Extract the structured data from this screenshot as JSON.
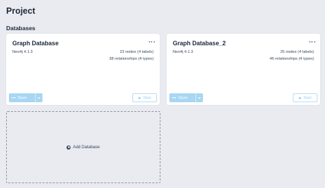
{
  "page": {
    "title": "Project"
  },
  "section": {
    "title": "Databases"
  },
  "cards": [
    {
      "name": "Graph Database",
      "version": "Neo4j 4.1.3",
      "nodes": "23 nodes (4 labels)",
      "relationships": "38 relationships (4 types)",
      "open_label": "Open",
      "start_label": "Start"
    },
    {
      "name": "Graph Database_2",
      "version": "Neo4j 4.1.3",
      "nodes": "25 nodes (4 labels)",
      "relationships": "46 relationships (4 types)",
      "open_label": "Open",
      "start_label": "Start"
    }
  ],
  "add_database": {
    "label": "Add Database"
  },
  "colors": {
    "background": "#e9ebf0",
    "open_button": "#a8d6f3",
    "start_border": "#b5ddf6"
  },
  "icons": {
    "more": "more-horizontal-icon",
    "open": "open-icon",
    "start": "play-icon",
    "add": "plus-circle-icon"
  }
}
